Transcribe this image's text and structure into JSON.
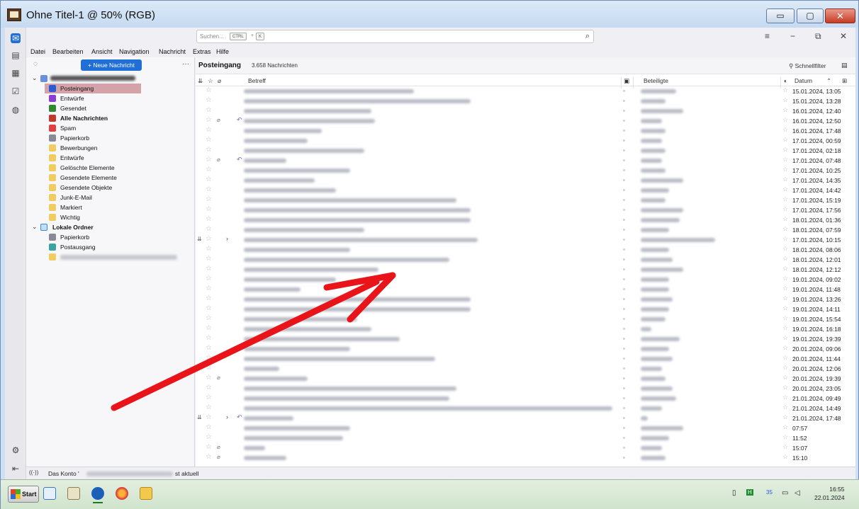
{
  "window": {
    "title": "Ohne Titel-1 @ 50% (RGB)",
    "min_glyph": "▭",
    "max_glyph": "▢",
    "close_glyph": "✕"
  },
  "topbar": {
    "search_placeholder": "Suchen...",
    "kbd_ctrl": "CTRL",
    "kbd_plus": "+",
    "kbd_k": "K"
  },
  "menu": [
    "Datei",
    "Bearbeiten",
    "Ansicht",
    "Navigation",
    "Nachricht",
    "Extras",
    "Hilfe"
  ],
  "folderpane": {
    "new_message": "+ Neue Nachricht",
    "more": "···",
    "folders": [
      {
        "label": "Posteingang",
        "bold": false,
        "icon": "inbox-icon",
        "color": "#2a5ad6",
        "selected": true
      },
      {
        "label": "Entwürfe",
        "bold": false,
        "icon": "drafts-icon",
        "color": "#8b3dd6"
      },
      {
        "label": "Gesendet",
        "bold": false,
        "icon": "sent-icon",
        "color": "#2f8a2f"
      },
      {
        "label": "Alle Nachrichten",
        "bold": true,
        "icon": "archive-icon",
        "color": "#c0392b"
      },
      {
        "label": "Spam",
        "bold": false,
        "icon": "spam-icon",
        "color": "#e04040"
      },
      {
        "label": "Papierkorb",
        "bold": false,
        "icon": "trash-icon",
        "color": "#8a8a95"
      },
      {
        "label": "Bewerbungen",
        "bold": false,
        "icon": "folder-icon",
        "color": "#f2cc5e"
      },
      {
        "label": "Entwürfe",
        "bold": false,
        "icon": "folder-icon",
        "color": "#f2cc5e"
      },
      {
        "label": "Gelöschte Elemente",
        "bold": false,
        "icon": "folder-icon",
        "color": "#f2cc5e"
      },
      {
        "label": "Gesendete Elemente",
        "bold": false,
        "icon": "folder-icon",
        "color": "#f2cc5e"
      },
      {
        "label": "Gesendete Objekte",
        "bold": false,
        "icon": "folder-icon",
        "color": "#f2cc5e"
      },
      {
        "label": "Junk-E-Mail",
        "bold": false,
        "icon": "folder-icon",
        "color": "#f2cc5e"
      },
      {
        "label": "Markiert",
        "bold": false,
        "icon": "folder-icon",
        "color": "#f2cc5e"
      },
      {
        "label": "Wichtig",
        "bold": false,
        "icon": "folder-icon",
        "color": "#f2cc5e"
      }
    ],
    "local_label": "Lokale Ordner",
    "local_folders": [
      {
        "label": "Papierkorb",
        "icon": "trash-icon",
        "color": "#8a8a95"
      },
      {
        "label": "Postausgang",
        "icon": "outbox-icon",
        "color": "#3aa3a0"
      }
    ]
  },
  "messagelist": {
    "title": "Posteingang",
    "count": "3.658 Nachrichten",
    "quickfilter": "Schnellfilter",
    "col_subject": "Betreff",
    "col_participants": "Beteiligte",
    "col_date": "Datum",
    "dates": [
      "15.01.2024, 13:05",
      "15.01.2024, 13:28",
      "16.01.2024, 12:40",
      "16.01.2024, 12:50",
      "16.01.2024, 17:48",
      "17.01.2024, 00:59",
      "17.01.2024, 02:18",
      "17.01.2024, 07:48",
      "17.01.2024, 10:25",
      "17.01.2024, 14:35",
      "17.01.2024, 14:42",
      "17.01.2024, 15:19",
      "17.01.2024, 17:56",
      "18.01.2024, 01:36",
      "18.01.2024, 07:59",
      "17.01.2024, 10:15",
      "18.01.2024, 08:06",
      "18.01.2024, 12:01",
      "18.01.2024, 12:12",
      "19.01.2024, 09:02",
      "19.01.2024, 11:48",
      "19.01.2024, 13:26",
      "19.01.2024, 14:11",
      "19.01.2024, 15:54",
      "19.01.2024, 16:18",
      "19.01.2024, 19:39",
      "20.01.2024, 09:06",
      "20.01.2024, 11:44",
      "20.01.2024, 12:06",
      "20.01.2024, 19:39",
      "20.01.2024, 23:05",
      "21.01.2024, 09:49",
      "21.01.2024, 14:49",
      "21.01.2024, 17:48",
      "07:57",
      "11:52",
      "15:07",
      "15:10"
    ]
  },
  "statusbar": {
    "prefix": "Das Konto '",
    "suffix": "st aktuell"
  },
  "taskbar": {
    "start": "Start",
    "time": "16:55",
    "date": "22.01.2024",
    "tray_num": "35"
  },
  "colors": {
    "accent": "#1f6fd6",
    "selection": "#d4a3aa",
    "arrow": "#e8141a"
  }
}
